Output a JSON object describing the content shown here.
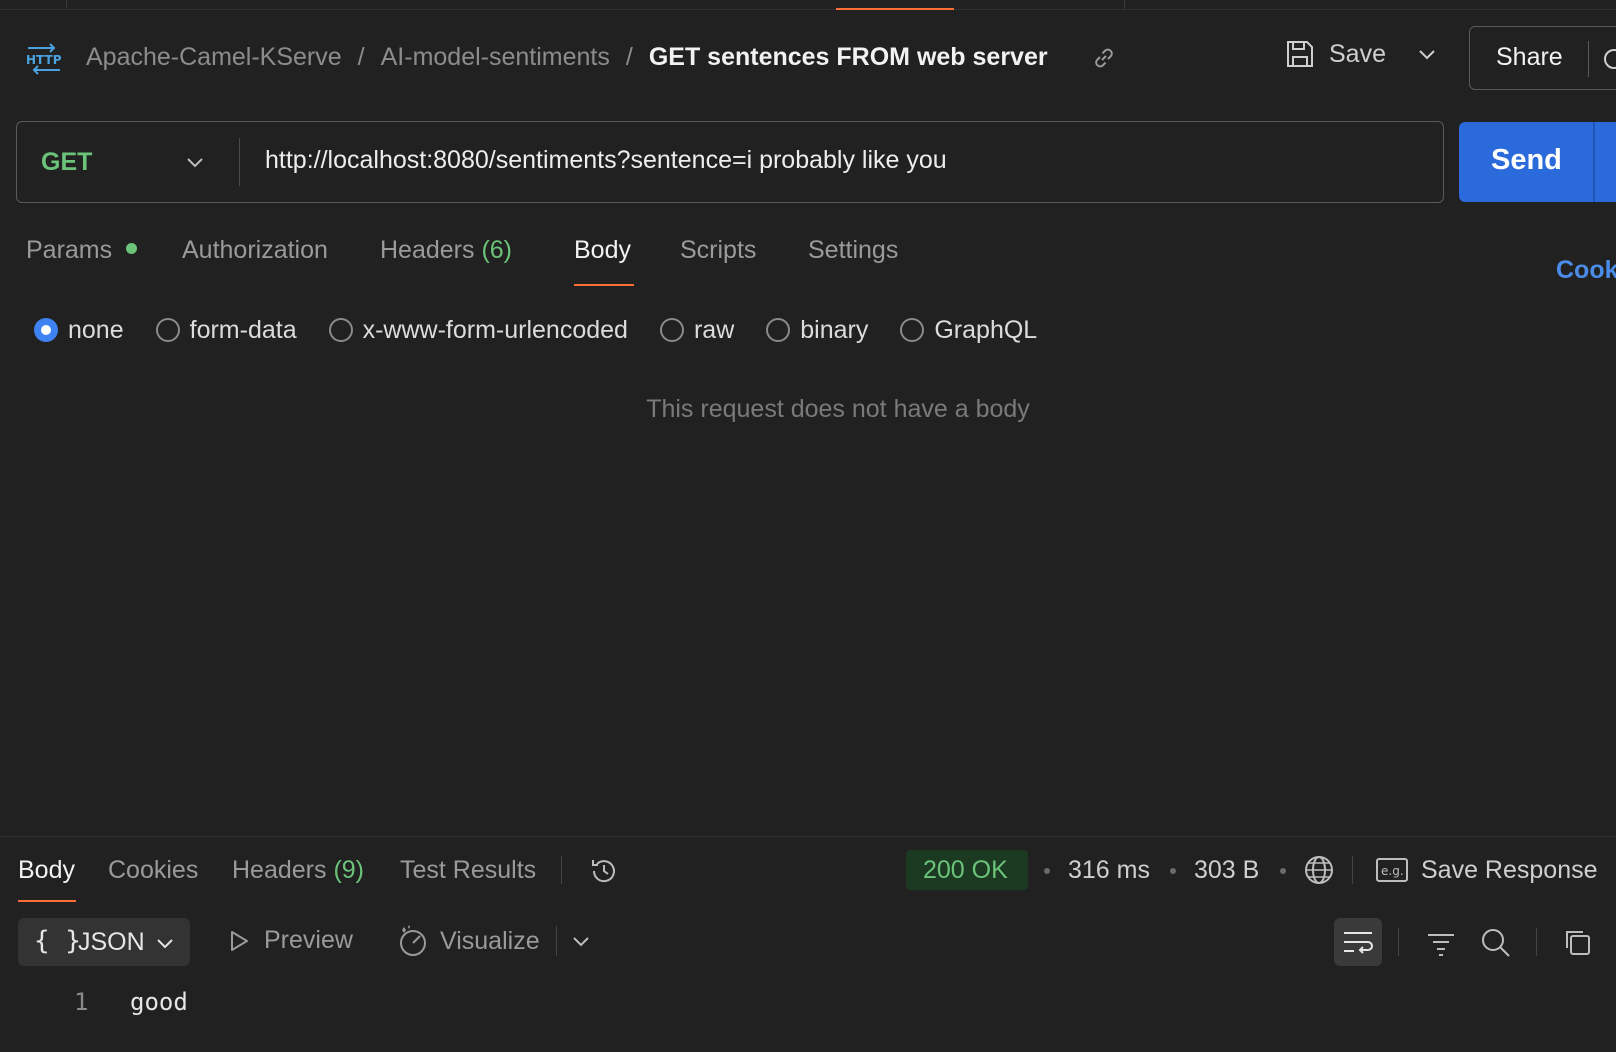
{
  "breadcrumb": {
    "collection": "Apache-Camel-KServe",
    "folder": "AI-model-sentiments",
    "request": "GET sentences FROM web server",
    "separator": "/"
  },
  "header": {
    "save_label": "Save",
    "share_label": "Share"
  },
  "request": {
    "method": "GET",
    "url": "http://localhost:8080/sentiments?sentence=i probably like you",
    "send_label": "Send"
  },
  "request_tabs": {
    "params": "Params",
    "authorization": "Authorization",
    "headers": "Headers",
    "headers_count": "(6)",
    "body": "Body",
    "scripts": "Scripts",
    "settings": "Settings",
    "cookies": "Cook"
  },
  "body_types": {
    "selected": "none",
    "options": [
      "none",
      "form-data",
      "x-www-form-urlencoded",
      "raw",
      "binary",
      "GraphQL"
    ]
  },
  "empty_body_message": "This request does not have a body",
  "response": {
    "tabs": {
      "body": "Body",
      "cookies": "Cookies",
      "headers": "Headers",
      "headers_count": "(9)",
      "test_results": "Test Results"
    },
    "status": "200 OK",
    "time": "316 ms",
    "size": "303 B",
    "save_response": "Save Response",
    "format": "JSON",
    "format_braces": "{ }",
    "preview_label": "Preview",
    "visualize_label": "Visualize",
    "lines": [
      {
        "number": "1",
        "text": "good"
      }
    ]
  },
  "colors": {
    "background": "#212121",
    "accent_orange": "#ff6c37",
    "send_blue": "#2a6adb",
    "method_green": "#6bc37a",
    "link_blue": "#4b8ce8"
  }
}
